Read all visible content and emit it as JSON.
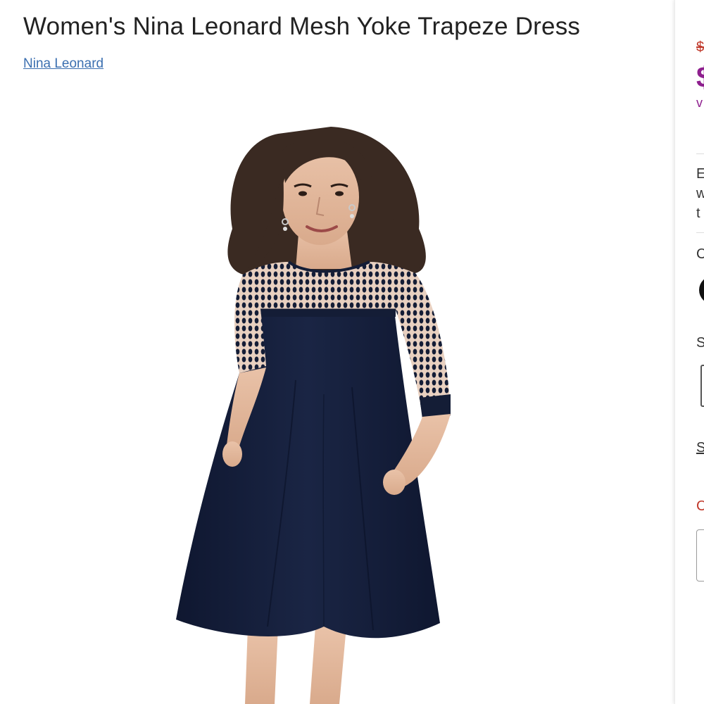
{
  "product": {
    "title": "Women's Nina Leonard Mesh Yoke Trapeze Dress",
    "brand": "Nina Leonard",
    "image_alt": "Model wearing navy trapeze dress with mesh yoke and three-quarter sleeves"
  },
  "right_panel": {
    "original_price_partial": "$",
    "sale_price_partial": "$",
    "price_note_partial": "v",
    "description_partial": [
      "E",
      "w",
      "t"
    ],
    "color_label_partial": "C",
    "size_label_partial": "S",
    "size_link_partial": "S",
    "alert_partial": "C"
  },
  "colors": {
    "title": "#222222",
    "brand_link": "#3b6fb0",
    "sale_price": "#8e1f8e",
    "original_price": "#c0392b",
    "dress": "#141d36",
    "swatch": "#111111"
  }
}
